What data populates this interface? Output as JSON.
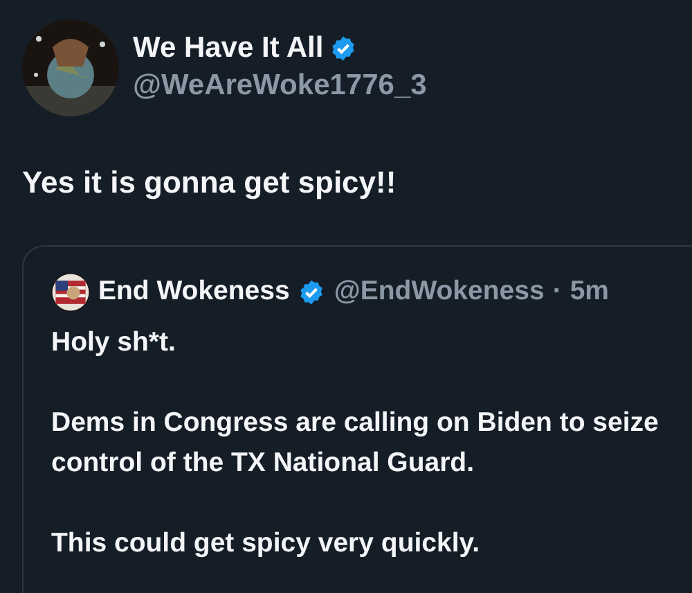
{
  "tweet": {
    "author": {
      "name": "We Have It All",
      "verified": true,
      "handle": "@WeAreWoke1776_3"
    },
    "text": "Yes it is gonna get spicy!!",
    "quote": {
      "author": {
        "name": "End Wokeness",
        "verified": true,
        "handle": "@EndWokeness",
        "separator": "·",
        "time": "5m"
      },
      "paragraphs": [
        "Holy sh*t.",
        "Dems in Congress are calling on Biden to seize control of the TX National Guard.",
        "This could get spicy very quickly."
      ]
    }
  }
}
